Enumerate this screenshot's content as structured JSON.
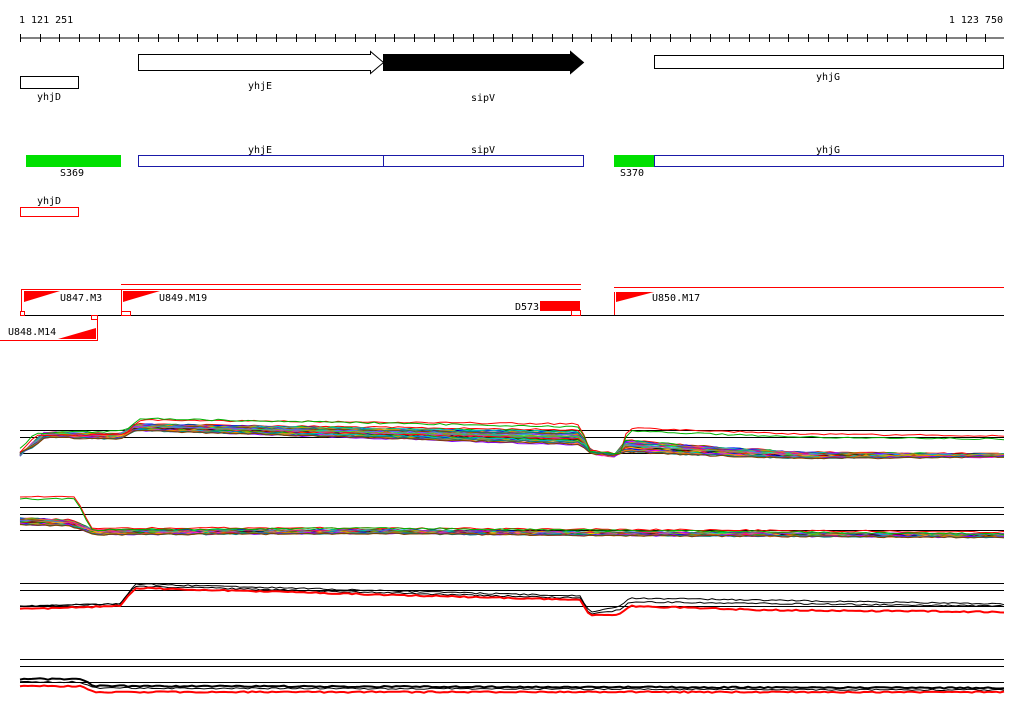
{
  "coordinates": {
    "start": "1 121 251",
    "end": "1 123 750"
  },
  "colors": {
    "ruler": "#000000",
    "gene_outline": "#000000",
    "selected_gene": "#000000",
    "operon": "#1a1aa8",
    "promoter": "#00e000",
    "annotation": "#ff0000",
    "track_line": "#000000"
  },
  "genes": [
    {
      "id": "yhjD",
      "label": "yhjD"
    },
    {
      "id": "yhjE",
      "label": "yhjE"
    },
    {
      "id": "sipV",
      "label": "sipV"
    },
    {
      "id": "yhjG",
      "label": "yhjG"
    }
  ],
  "promoters": [
    {
      "id": "S369",
      "label": "S369"
    },
    {
      "id": "S370",
      "label": "S370"
    }
  ],
  "operon_genes": [
    {
      "id": "yhjE",
      "label": "yhjE"
    },
    {
      "id": "sipV",
      "label": "sipV"
    },
    {
      "id": "yhjG",
      "label": "yhjG"
    }
  ],
  "red_gene": {
    "id": "yhjD",
    "label": "yhjD"
  },
  "transcripts": [
    {
      "id": "U847.M3",
      "label": "U847.M3"
    },
    {
      "id": "U849.M19",
      "label": "U849.M19"
    },
    {
      "id": "D573",
      "label": "D573"
    },
    {
      "id": "U850.M17",
      "label": "U850.M17"
    },
    {
      "id": "U848.M14",
      "label": "U848.M14"
    }
  ],
  "expression_tracks": [
    {
      "id": "track-1",
      "type": "multi"
    },
    {
      "id": "track-2",
      "type": "multi"
    },
    {
      "id": "track-3",
      "type": "black-red"
    },
    {
      "id": "track-4",
      "type": "black-red"
    }
  ]
}
